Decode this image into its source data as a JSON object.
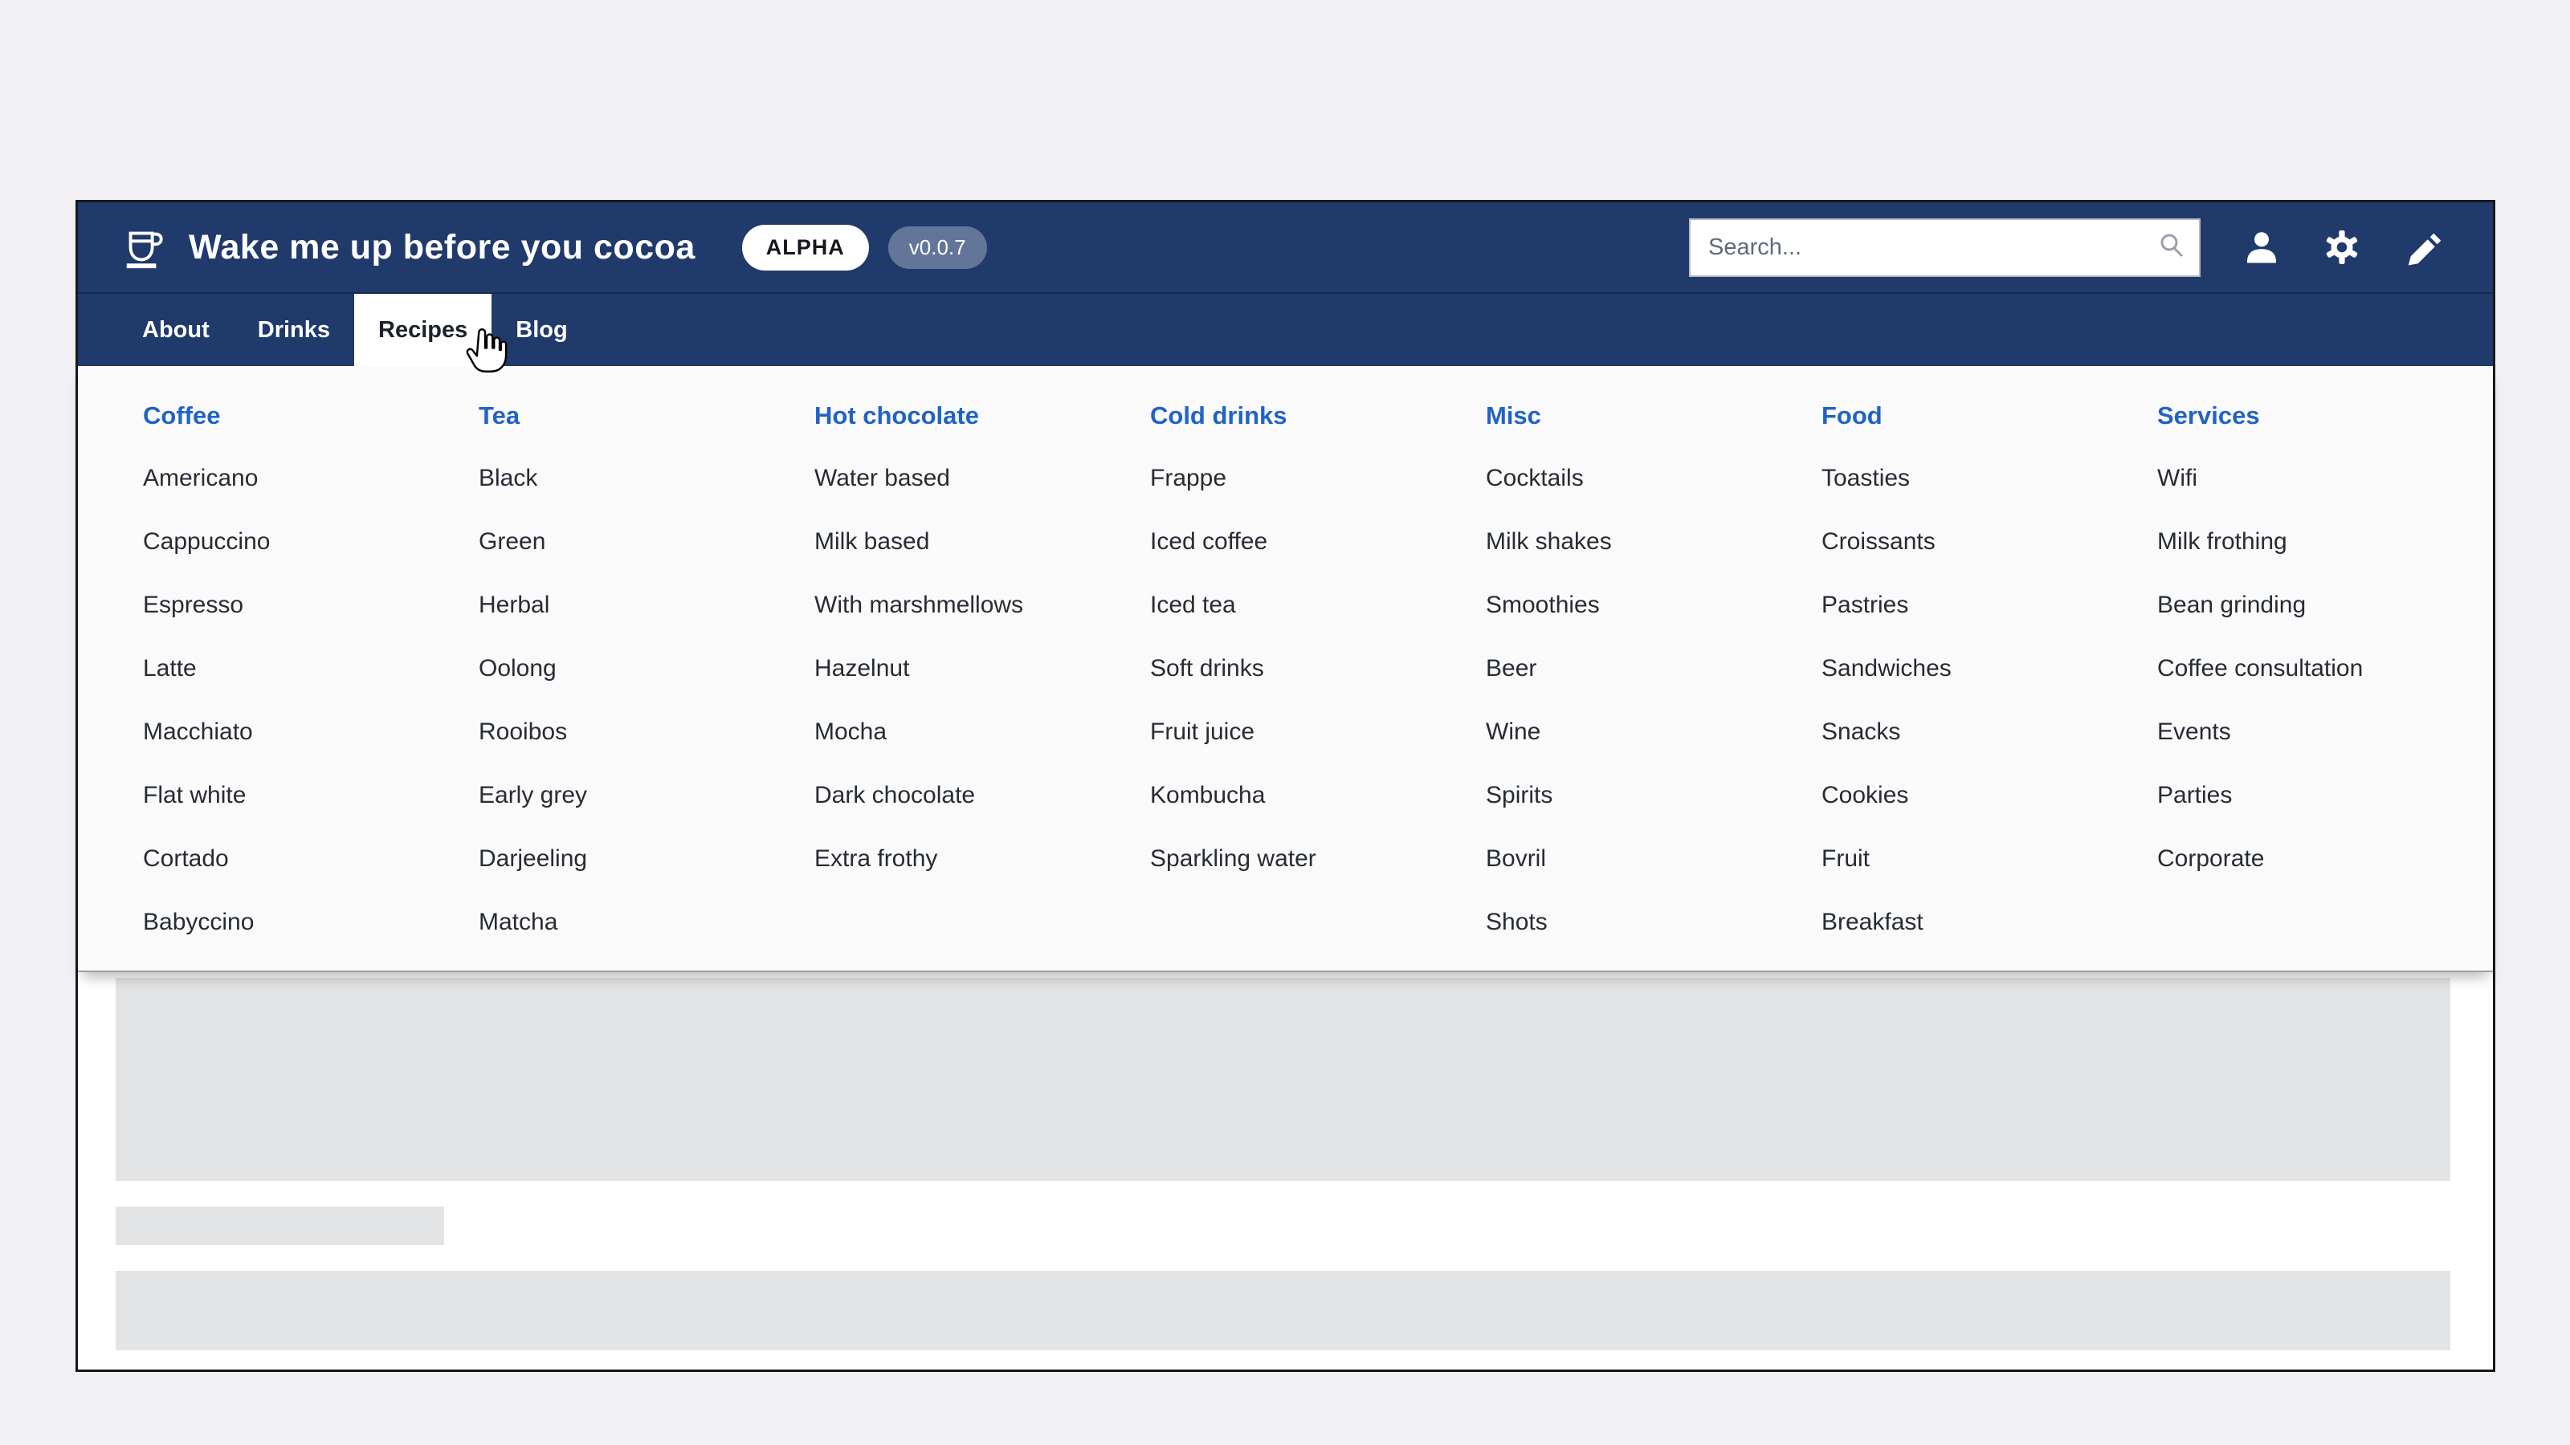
{
  "header": {
    "logo_icon": "coffee-cup-icon",
    "title": "Wake me up before you cocoa",
    "badge_label": "ALPHA",
    "version_label": "v0.0.7",
    "search": {
      "placeholder": "Search...",
      "value": "",
      "icon": "search-icon"
    },
    "action_icons": [
      "user-icon",
      "gear-icon",
      "pencil-icon"
    ]
  },
  "nav": {
    "tabs": [
      {
        "label": "About",
        "active": false
      },
      {
        "label": "Drinks",
        "active": false
      },
      {
        "label": "Recipes",
        "active": true
      },
      {
        "label": "Blog",
        "active": false
      }
    ]
  },
  "menu": {
    "columns": [
      {
        "title": "Coffee",
        "items": [
          "Americano",
          "Cappuccino",
          "Espresso",
          "Latte",
          "Macchiato",
          "Flat white",
          "Cortado",
          "Babyccino"
        ]
      },
      {
        "title": "Tea",
        "items": [
          "Black",
          "Green",
          "Herbal",
          "Oolong",
          "Rooibos",
          "Early grey",
          "Darjeeling",
          "Matcha"
        ]
      },
      {
        "title": "Hot chocolate",
        "items": [
          "Water based",
          "Milk based",
          "With marshmellows",
          "Hazelnut",
          "Mocha",
          "Dark chocolate",
          "Extra frothy"
        ]
      },
      {
        "title": "Cold drinks",
        "items": [
          "Frappe",
          "Iced coffee",
          "Iced tea",
          "Soft drinks",
          "Fruit juice",
          "Kombucha",
          "Sparkling water"
        ]
      },
      {
        "title": "Misc",
        "items": [
          "Cocktails",
          "Milk shakes",
          "Smoothies",
          "Beer",
          "Wine",
          "Spirits",
          "Bovril",
          "Shots"
        ]
      },
      {
        "title": "Food",
        "items": [
          "Toasties",
          "Croissants",
          "Pastries",
          "Sandwiches",
          "Snacks",
          "Cookies",
          "Fruit",
          "Breakfast"
        ]
      },
      {
        "title": "Services",
        "items": [
          "Wifi",
          "Milk frothing",
          "Bean grinding",
          "Coffee consultation",
          "Events",
          "Parties",
          "Corporate"
        ]
      }
    ]
  },
  "cursor_icon": "hand-pointer-cursor-icon",
  "colors": {
    "header_bar": "#203a6c",
    "accent_blue": "#2163c5",
    "active_tab_bg": "#ffffff",
    "badge_bg": "#ffffff",
    "badge_text": "#15171c",
    "version_pill_bg": "rgba(255,255,255,0.3)",
    "menu_bg": "#fafafa",
    "placeholder_gray": "#e3e4e6",
    "page_bg": "#f1f1f3"
  }
}
